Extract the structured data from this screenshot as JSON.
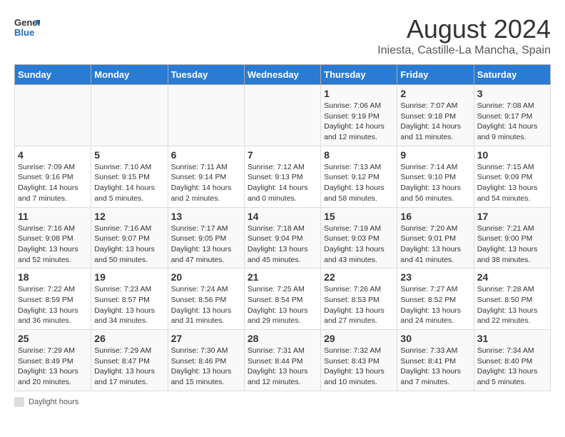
{
  "logo": {
    "general": "General",
    "blue": "Blue"
  },
  "title": "August 2024",
  "subtitle": "Iniesta, Castille-La Mancha, Spain",
  "days_of_week": [
    "Sunday",
    "Monday",
    "Tuesday",
    "Wednesday",
    "Thursday",
    "Friday",
    "Saturday"
  ],
  "footer": {
    "box_label": "Daylight hours"
  },
  "weeks": [
    [
      {
        "day": "",
        "info": ""
      },
      {
        "day": "",
        "info": ""
      },
      {
        "day": "",
        "info": ""
      },
      {
        "day": "",
        "info": ""
      },
      {
        "day": "1",
        "info": "Sunrise: 7:06 AM\nSunset: 9:19 PM\nDaylight: 14 hours\nand 12 minutes."
      },
      {
        "day": "2",
        "info": "Sunrise: 7:07 AM\nSunset: 9:18 PM\nDaylight: 14 hours\nand 11 minutes."
      },
      {
        "day": "3",
        "info": "Sunrise: 7:08 AM\nSunset: 9:17 PM\nDaylight: 14 hours\nand 9 minutes."
      }
    ],
    [
      {
        "day": "4",
        "info": "Sunrise: 7:09 AM\nSunset: 9:16 PM\nDaylight: 14 hours\nand 7 minutes."
      },
      {
        "day": "5",
        "info": "Sunrise: 7:10 AM\nSunset: 9:15 PM\nDaylight: 14 hours\nand 5 minutes."
      },
      {
        "day": "6",
        "info": "Sunrise: 7:11 AM\nSunset: 9:14 PM\nDaylight: 14 hours\nand 2 minutes."
      },
      {
        "day": "7",
        "info": "Sunrise: 7:12 AM\nSunset: 9:13 PM\nDaylight: 14 hours\nand 0 minutes."
      },
      {
        "day": "8",
        "info": "Sunrise: 7:13 AM\nSunset: 9:12 PM\nDaylight: 13 hours\nand 58 minutes."
      },
      {
        "day": "9",
        "info": "Sunrise: 7:14 AM\nSunset: 9:10 PM\nDaylight: 13 hours\nand 56 minutes."
      },
      {
        "day": "10",
        "info": "Sunrise: 7:15 AM\nSunset: 9:09 PM\nDaylight: 13 hours\nand 54 minutes."
      }
    ],
    [
      {
        "day": "11",
        "info": "Sunrise: 7:16 AM\nSunset: 9:08 PM\nDaylight: 13 hours\nand 52 minutes."
      },
      {
        "day": "12",
        "info": "Sunrise: 7:16 AM\nSunset: 9:07 PM\nDaylight: 13 hours\nand 50 minutes."
      },
      {
        "day": "13",
        "info": "Sunrise: 7:17 AM\nSunset: 9:05 PM\nDaylight: 13 hours\nand 47 minutes."
      },
      {
        "day": "14",
        "info": "Sunrise: 7:18 AM\nSunset: 9:04 PM\nDaylight: 13 hours\nand 45 minutes."
      },
      {
        "day": "15",
        "info": "Sunrise: 7:19 AM\nSunset: 9:03 PM\nDaylight: 13 hours\nand 43 minutes."
      },
      {
        "day": "16",
        "info": "Sunrise: 7:20 AM\nSunset: 9:01 PM\nDaylight: 13 hours\nand 41 minutes."
      },
      {
        "day": "17",
        "info": "Sunrise: 7:21 AM\nSunset: 9:00 PM\nDaylight: 13 hours\nand 38 minutes."
      }
    ],
    [
      {
        "day": "18",
        "info": "Sunrise: 7:22 AM\nSunset: 8:59 PM\nDaylight: 13 hours\nand 36 minutes."
      },
      {
        "day": "19",
        "info": "Sunrise: 7:23 AM\nSunset: 8:57 PM\nDaylight: 13 hours\nand 34 minutes."
      },
      {
        "day": "20",
        "info": "Sunrise: 7:24 AM\nSunset: 8:56 PM\nDaylight: 13 hours\nand 31 minutes."
      },
      {
        "day": "21",
        "info": "Sunrise: 7:25 AM\nSunset: 8:54 PM\nDaylight: 13 hours\nand 29 minutes."
      },
      {
        "day": "22",
        "info": "Sunrise: 7:26 AM\nSunset: 8:53 PM\nDaylight: 13 hours\nand 27 minutes."
      },
      {
        "day": "23",
        "info": "Sunrise: 7:27 AM\nSunset: 8:52 PM\nDaylight: 13 hours\nand 24 minutes."
      },
      {
        "day": "24",
        "info": "Sunrise: 7:28 AM\nSunset: 8:50 PM\nDaylight: 13 hours\nand 22 minutes."
      }
    ],
    [
      {
        "day": "25",
        "info": "Sunrise: 7:29 AM\nSunset: 8:49 PM\nDaylight: 13 hours\nand 20 minutes."
      },
      {
        "day": "26",
        "info": "Sunrise: 7:29 AM\nSunset: 8:47 PM\nDaylight: 13 hours\nand 17 minutes."
      },
      {
        "day": "27",
        "info": "Sunrise: 7:30 AM\nSunset: 8:46 PM\nDaylight: 13 hours\nand 15 minutes."
      },
      {
        "day": "28",
        "info": "Sunrise: 7:31 AM\nSunset: 8:44 PM\nDaylight: 13 hours\nand 12 minutes."
      },
      {
        "day": "29",
        "info": "Sunrise: 7:32 AM\nSunset: 8:43 PM\nDaylight: 13 hours\nand 10 minutes."
      },
      {
        "day": "30",
        "info": "Sunrise: 7:33 AM\nSunset: 8:41 PM\nDaylight: 13 hours\nand 7 minutes."
      },
      {
        "day": "31",
        "info": "Sunrise: 7:34 AM\nSunset: 8:40 PM\nDaylight: 13 hours\nand 5 minutes."
      }
    ]
  ]
}
